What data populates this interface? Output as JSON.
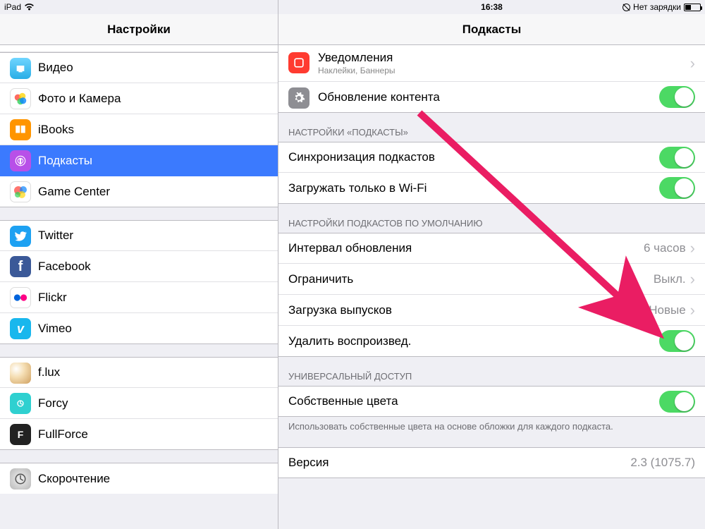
{
  "statusbar": {
    "device": "iPad",
    "time": "16:38",
    "charging_text": "Нет зарядки"
  },
  "left_header": {
    "title": "Настройки"
  },
  "right_header": {
    "title": "Подкасты"
  },
  "sidebar": {
    "items": [
      {
        "label": "Видео",
        "color": "#2aaee6"
      },
      {
        "label": "Фото и Камера",
        "color": "#ffffff"
      },
      {
        "label": "iBooks",
        "color": "#ff9500"
      },
      {
        "label": "Подкасты",
        "color": "#b850e8"
      },
      {
        "label": "Game Center",
        "color": "#ffffff"
      }
    ],
    "social": [
      {
        "label": "Twitter",
        "color": "#1da1f2"
      },
      {
        "label": "Facebook",
        "color": "#3b5998"
      },
      {
        "label": "Flickr",
        "color": "#ffffff"
      },
      {
        "label": "Vimeo",
        "color": "#19b7ed"
      }
    ],
    "apps": [
      {
        "label": "f.lux",
        "color": "#d6b98a"
      },
      {
        "label": "Forcy",
        "color": "#2fd0d0"
      },
      {
        "label": "FullForce",
        "color": "#222222"
      }
    ],
    "more": [
      {
        "label": "Скорочтение",
        "color": "#d0d0d0"
      }
    ]
  },
  "detail": {
    "topgroup": {
      "notifications": {
        "label": "Уведомления",
        "sub": "Наклейки, Баннеры"
      },
      "refresh": {
        "label": "Обновление контента",
        "on": true
      }
    },
    "section_podcast": {
      "header": "НАСТРОЙКИ «ПОДКАСТЫ»",
      "sync": {
        "label": "Синхронизация подкастов",
        "on": true
      },
      "wifi": {
        "label": "Загружать только в Wi-Fi",
        "on": true
      }
    },
    "section_default": {
      "header": "НАСТРОЙКИ ПОДКАСТОВ ПО УМОЛЧАНИЮ",
      "interval": {
        "label": "Интервал обновления",
        "value": "6 часов"
      },
      "limit": {
        "label": "Ограничить",
        "value": "Выкл."
      },
      "download": {
        "label": "Загрузка выпусков",
        "value": "Новые"
      },
      "delete": {
        "label": "Удалить воспроизвед.",
        "on": true
      }
    },
    "section_universal": {
      "header": "УНИВЕРСАЛЬНЫЙ ДОСТУП",
      "colors": {
        "label": "Собственные цвета",
        "on": true
      },
      "footer": "Использовать собственные цвета на основе обложки для каждого подкаста."
    },
    "version": {
      "label": "Версия",
      "value": "2.3 (1075.7)"
    }
  }
}
